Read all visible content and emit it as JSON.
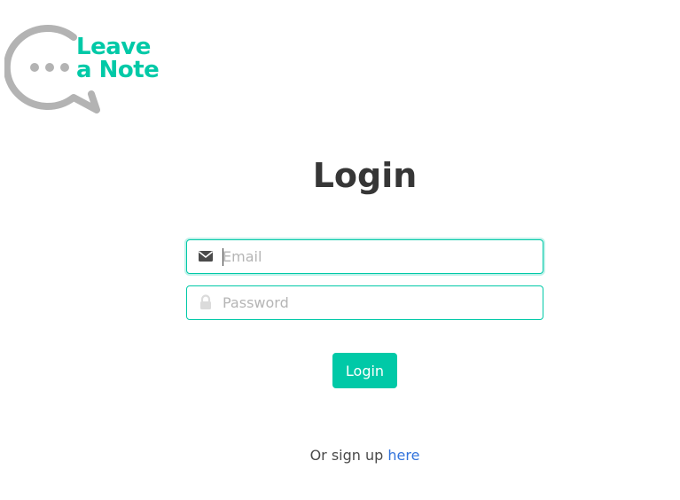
{
  "logo": {
    "line1": "Leave",
    "line2": "a Note",
    "brand_color": "#00c9a7",
    "bubble_color": "#b3b3b3"
  },
  "page": {
    "title": "Login"
  },
  "form": {
    "email_placeholder": "Email",
    "email_value": "",
    "password_placeholder": "Password",
    "password_value": "",
    "login_label": "Login"
  },
  "signup": {
    "prefix": "Or sign up",
    "link_label": "here"
  },
  "icons": {
    "email": "envelope-icon",
    "password": "lock-icon"
  }
}
